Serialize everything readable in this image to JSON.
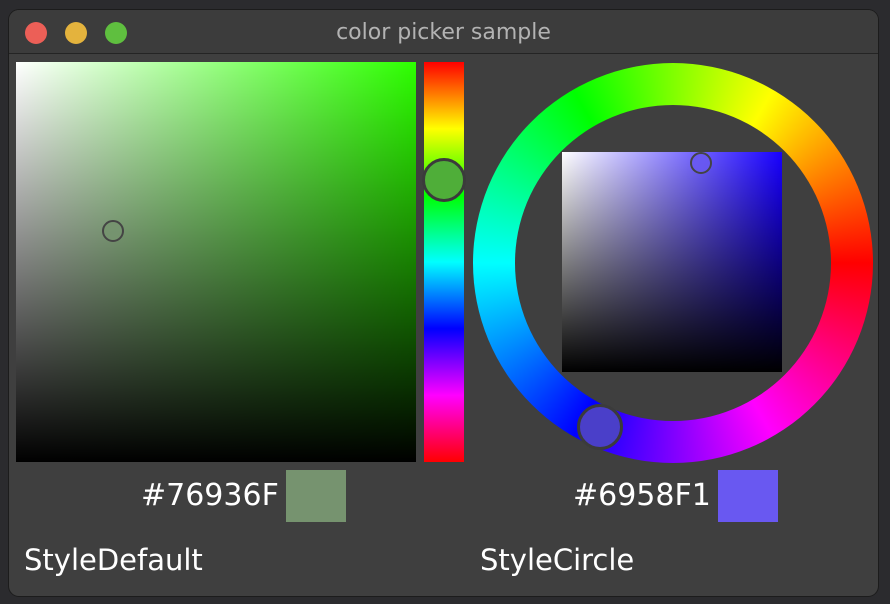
{
  "window": {
    "title": "color picker sample"
  },
  "default_picker": {
    "style_label": "StyleDefault",
    "hex": "#76936F",
    "swatch_color": "#76936F",
    "hue_handle_color": "#4FAE39",
    "area_hue_color": "#2DFF00"
  },
  "circle_picker": {
    "style_label": "StyleCircle",
    "hex": "#6958F1",
    "swatch_color": "#6958F1",
    "wheel_handle_color": "#4A3FC9",
    "area_hue_color": "#1800FF"
  },
  "icons": {
    "close": "close-icon",
    "minimize": "minimize-icon",
    "maximize": "maximize-icon"
  },
  "colors": {
    "close": "#EC5F57",
    "minimize": "#E4B33D",
    "maximize": "#5FBF3F",
    "window_bg": "#3F3F3F"
  }
}
